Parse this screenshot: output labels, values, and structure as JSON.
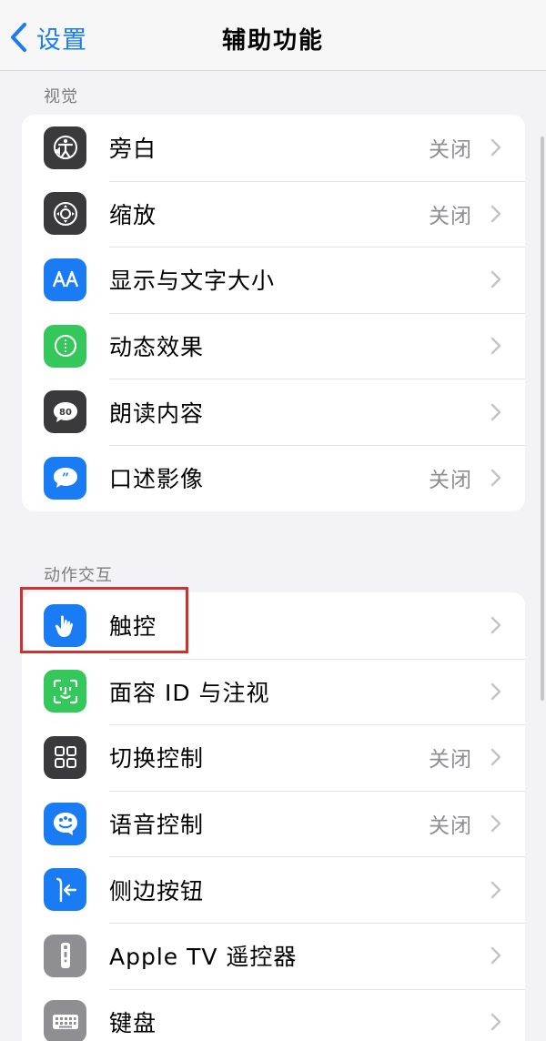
{
  "nav": {
    "back_label": "设置",
    "title": "辅助功能"
  },
  "sections": [
    {
      "header": "视觉",
      "items": [
        {
          "label": "旁白",
          "value": "关闭",
          "icon": "voiceover-icon",
          "color": "#3a3a3c"
        },
        {
          "label": "缩放",
          "value": "关闭",
          "icon": "zoom-icon",
          "color": "#3a3a3c"
        },
        {
          "label": "显示与文字大小",
          "value": "",
          "icon": "text-size-icon",
          "color": "#1a7cf5"
        },
        {
          "label": "动态效果",
          "value": "",
          "icon": "motion-icon",
          "color": "#34c759"
        },
        {
          "label": "朗读内容",
          "value": "",
          "icon": "spoken-content-icon",
          "color": "#3a3a3c"
        },
        {
          "label": "口述影像",
          "value": "关闭",
          "icon": "audio-description-icon",
          "color": "#1a7cf5"
        }
      ]
    },
    {
      "header": "动作交互",
      "items": [
        {
          "label": "触控",
          "value": "",
          "icon": "touch-icon",
          "color": "#1a7cf5"
        },
        {
          "label": "面容 ID 与注视",
          "value": "",
          "icon": "face-id-icon",
          "color": "#34c759"
        },
        {
          "label": "切换控制",
          "value": "关闭",
          "icon": "switch-control-icon",
          "color": "#3a3a3c"
        },
        {
          "label": "语音控制",
          "value": "关闭",
          "icon": "voice-control-icon",
          "color": "#1a7cf5"
        },
        {
          "label": "侧边按钮",
          "value": "",
          "icon": "side-button-icon",
          "color": "#1a7cf5"
        },
        {
          "label": "Apple TV 遥控器",
          "value": "",
          "icon": "apple-tv-remote-icon",
          "color": "#8e8e93"
        },
        {
          "label": "键盘",
          "value": "",
          "icon": "keyboard-icon",
          "color": "#8e8e93"
        }
      ]
    }
  ]
}
